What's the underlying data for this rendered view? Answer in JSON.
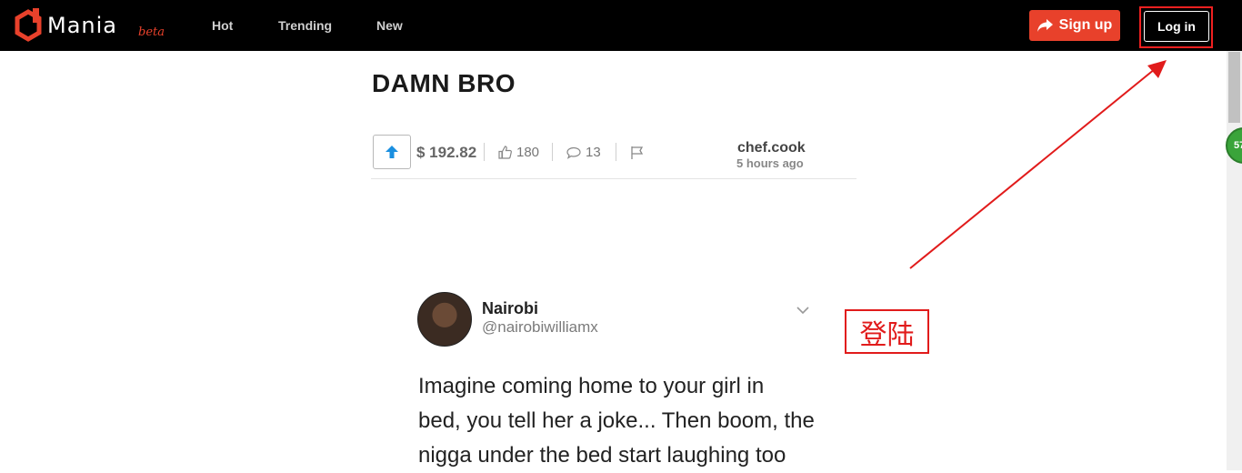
{
  "brand": {
    "name": "Mania",
    "tag": "beta"
  },
  "nav": {
    "hot": "Hot",
    "trending": "Trending",
    "new": "New"
  },
  "actions": {
    "signup": "Sign up",
    "login": "Log in"
  },
  "badge": {
    "value": "57"
  },
  "post": {
    "title": "DAMN BRO",
    "payout": "$ 192.82",
    "likes": "180",
    "comments": "13",
    "author": "chef.cook",
    "time": "5 hours ago"
  },
  "tweet": {
    "name": "Nairobi",
    "handle": "@nairobiwilliamx",
    "lines": [
      "Imagine coming home to your girl in",
      "bed, you tell her a joke... Then boom, the",
      "nigga under the bed start laughing too"
    ]
  },
  "annotation": {
    "label": "登陆"
  },
  "colors": {
    "accent": "#e8412b",
    "navbar": "#000000",
    "annotation": "#e11b1b"
  },
  "icons": [
    "logo-icon",
    "share-arrow-icon",
    "upvote-arrow-icon",
    "thumbs-up-icon",
    "comment-icon",
    "flag-icon",
    "chevron-down-icon"
  ]
}
